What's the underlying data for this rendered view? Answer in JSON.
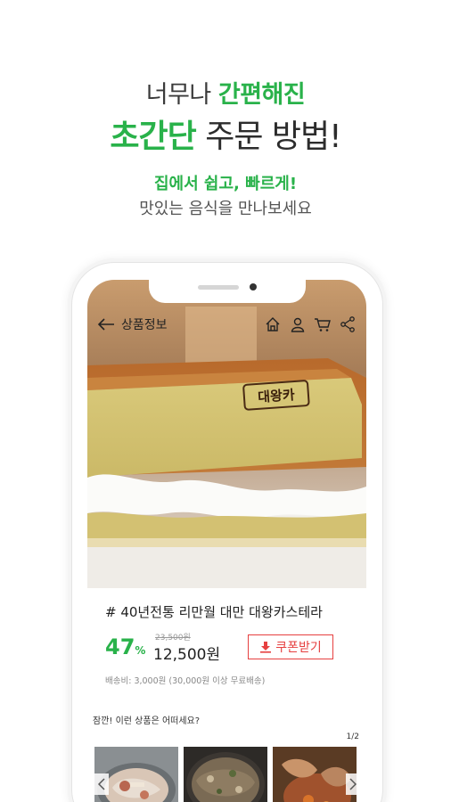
{
  "headline": {
    "line1_plain": "너무나 ",
    "line1_green": "간편해진",
    "line2_green": "초간단",
    "line2_plain": " 주문 방법!",
    "sub1": "집에서 쉽고, 빠르게!",
    "sub2": "맛있는 음식을 만나보세요"
  },
  "app": {
    "page_title": "상품정보",
    "icons": [
      "back-arrow-icon",
      "home-icon",
      "user-icon",
      "cart-icon",
      "share-icon"
    ],
    "logo_text": "대왕카"
  },
  "product": {
    "name": "# 40년전통 리만월 대만 대왕카스테라",
    "discount": "47",
    "discount_unit": "%",
    "original_price": "23,500원",
    "price": "12,500원",
    "coupon_label": "쿠폰받기",
    "shipping": "배송비: 3,000원 (30,000원 이상 무료배송)"
  },
  "recommend": {
    "title": "잠깐! 이런 상품은 어떠세요?",
    "pager": "1/2"
  },
  "colors": {
    "accent_green": "#29b24a",
    "coupon_red": "#e64040"
  }
}
